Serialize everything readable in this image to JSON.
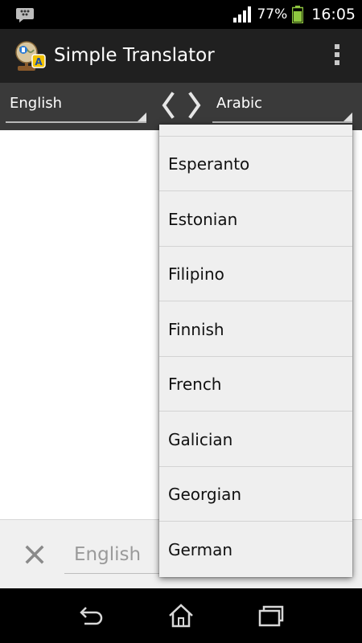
{
  "status_bar": {
    "notification_icon": "bbm-icon",
    "signal_icon": "signal-bars-icon",
    "battery_percent": "77%",
    "battery_icon": "battery-icon",
    "time": "16:05"
  },
  "action_bar": {
    "app_icon": "translator-globe-icon",
    "title": "Simple Translator",
    "overflow_icon": "overflow-menu-icon"
  },
  "language_bar": {
    "source_language": "English",
    "target_language": "Arabic",
    "swap_left_icon": "chevron-left-icon",
    "swap_right_icon": "chevron-right-icon"
  },
  "dropdown": {
    "items": [
      {
        "label": ""
      },
      {
        "label": "Esperanto"
      },
      {
        "label": "Estonian"
      },
      {
        "label": "Filipino"
      },
      {
        "label": "Finnish"
      },
      {
        "label": "French"
      },
      {
        "label": "Galician"
      },
      {
        "label": "Georgian"
      },
      {
        "label": "German"
      }
    ]
  },
  "input_bar": {
    "clear_icon": "close-icon",
    "placeholder": "English"
  },
  "nav_bar": {
    "back_icon": "back-icon",
    "home_icon": "home-icon",
    "recents_icon": "recents-icon"
  },
  "colors": {
    "action_bar_bg": "#202020",
    "language_bar_bg": "#3a3a3a",
    "dropdown_bg": "#efefef",
    "battery_green": "#8ec63f"
  }
}
